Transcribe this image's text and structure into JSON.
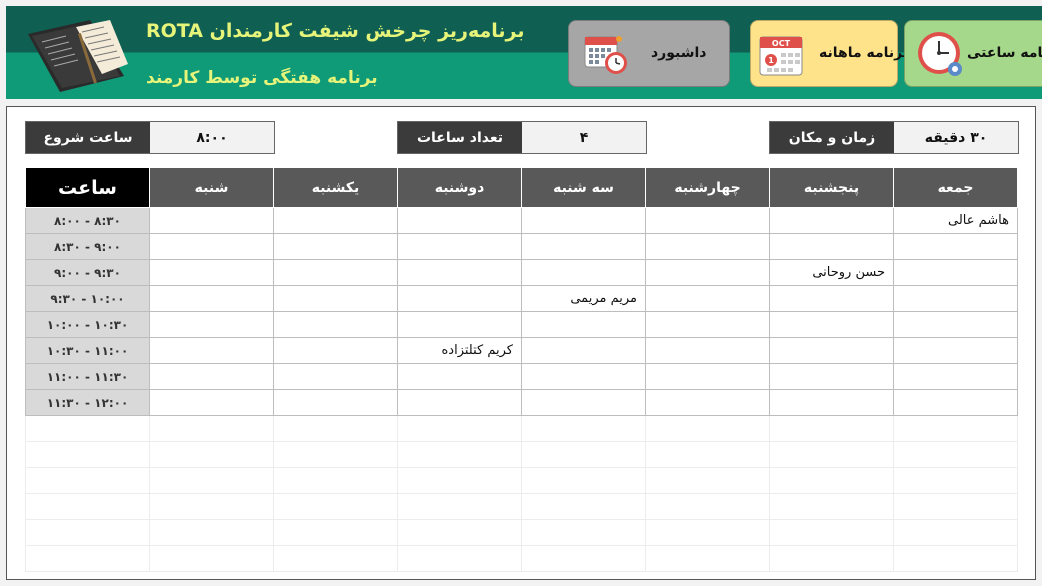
{
  "header": {
    "title": "برنامه‌ریز چرخش شیفت کارمندان ROTA",
    "subtitle": "برنامه هفتگی توسط کارمند",
    "logo_icon": "notebook-icon"
  },
  "nav": {
    "dashboard_label": "داشبورد",
    "monthly_label": "برنامه ماهانه",
    "hourly_label": "برنامه ساعتی",
    "monthly_icon_month": "OCT",
    "monthly_icon_day": "1"
  },
  "info": {
    "start_time_label": "ساعت شروع",
    "start_time_value": "۸:۰۰",
    "hours_count_label": "تعداد ساعات",
    "hours_count_value": "۴",
    "time_place_label": "زمان و مکان",
    "time_place_value": "۳۰ دقیقه"
  },
  "schedule": {
    "time_header": "ساعت",
    "days": [
      "شنبه",
      "یکشنبه",
      "دوشنبه",
      "سه شنبه",
      "چهارشنبه",
      "پنجشنبه",
      "جمعه"
    ],
    "rows": [
      {
        "time": "۸:۰۰ - ۸:۳۰",
        "cells": [
          "",
          "",
          "",
          "",
          "",
          "",
          "هاشم عالی"
        ]
      },
      {
        "time": "۸:۳۰ - ۹:۰۰",
        "cells": [
          "",
          "",
          "",
          "",
          "",
          "",
          ""
        ]
      },
      {
        "time": "۹:۰۰ - ۹:۳۰",
        "cells": [
          "",
          "",
          "",
          "",
          "",
          "حسن روحانی",
          ""
        ]
      },
      {
        "time": "۹:۳۰ - ۱۰:۰۰",
        "cells": [
          "",
          "",
          "",
          "مریم مریمی",
          "",
          "",
          ""
        ]
      },
      {
        "time": "۱۰:۰۰ - ۱۰:۳۰",
        "cells": [
          "",
          "",
          "",
          "",
          "",
          "",
          ""
        ]
      },
      {
        "time": "۱۰:۳۰ - ۱۱:۰۰",
        "cells": [
          "",
          "",
          "کریم کتلتزاده",
          "",
          "",
          "",
          ""
        ]
      },
      {
        "time": "۱۱:۰۰ - ۱۱:۳۰",
        "cells": [
          "",
          "",
          "",
          "",
          "",
          "",
          ""
        ]
      },
      {
        "time": "۱۱:۳۰ - ۱۲:۰۰",
        "cells": [
          "",
          "",
          "",
          "",
          "",
          "",
          ""
        ]
      }
    ]
  },
  "colors": {
    "header_dark": "#0f5f52",
    "header_light": "#0f9a78",
    "title_text": "#e6f47a",
    "dashboard_btn": "#a6a6a6",
    "monthly_btn": "#ffe38a",
    "hourly_btn": "#a5d88a",
    "table_header": "#595959",
    "time_col": "#d9d9d9"
  }
}
